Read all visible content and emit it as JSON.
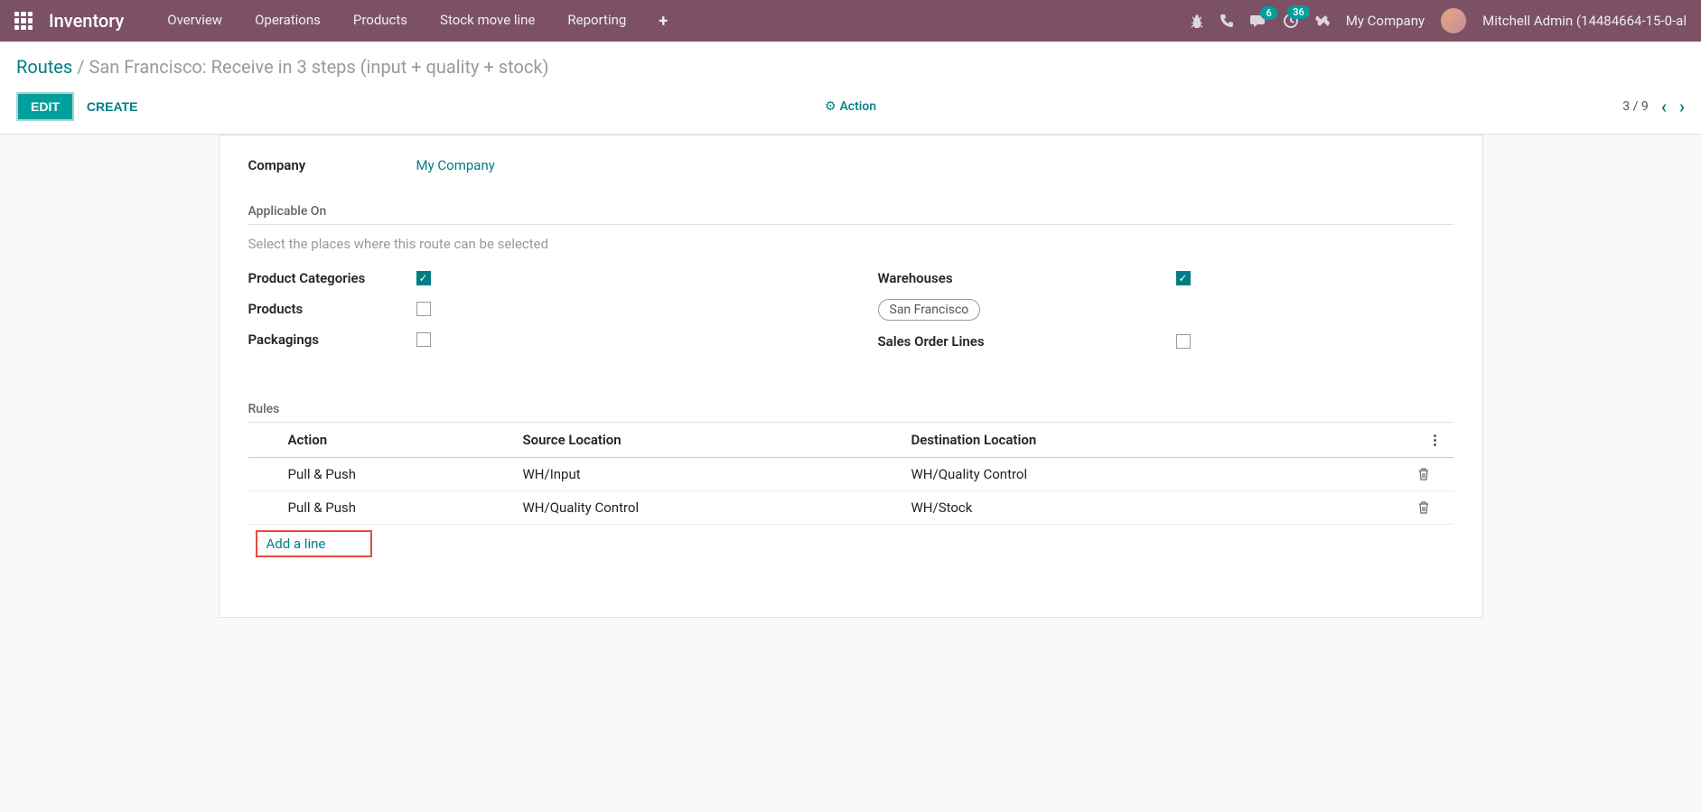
{
  "topbar": {
    "app_title": "Inventory",
    "nav": [
      "Overview",
      "Operations",
      "Products",
      "Stock move line",
      "Reporting"
    ],
    "company": "My Company",
    "user": "Mitchell Admin (14484664-15-0-al",
    "msg_badge": "6",
    "activity_badge": "36"
  },
  "breadcrumb": {
    "root": "Routes",
    "sep": "/",
    "current": "San Francisco: Receive in 3 steps (input + quality + stock)"
  },
  "actions": {
    "edit": "EDIT",
    "create": "CREATE",
    "action": "Action"
  },
  "pager": {
    "count": "3 / 9"
  },
  "form": {
    "company_label": "Company",
    "company_value": "My Company",
    "applicable_on": "Applicable On",
    "applicable_note": "Select the places where this route can be selected",
    "left": {
      "product_categories": "Product Categories",
      "products": "Products",
      "packagings": "Packagings"
    },
    "right": {
      "warehouses": "Warehouses",
      "warehouse_tag": "San Francisco",
      "sales_order_lines": "Sales Order Lines"
    },
    "rules": {
      "title": "Rules",
      "headers": {
        "action": "Action",
        "source": "Source Location",
        "dest": "Destination Location"
      },
      "rows": [
        {
          "action": "Pull & Push",
          "source": "WH/Input",
          "dest": "WH/Quality Control"
        },
        {
          "action": "Pull & Push",
          "source": "WH/Quality Control",
          "dest": "WH/Stock"
        }
      ],
      "add_line": "Add a line"
    }
  }
}
